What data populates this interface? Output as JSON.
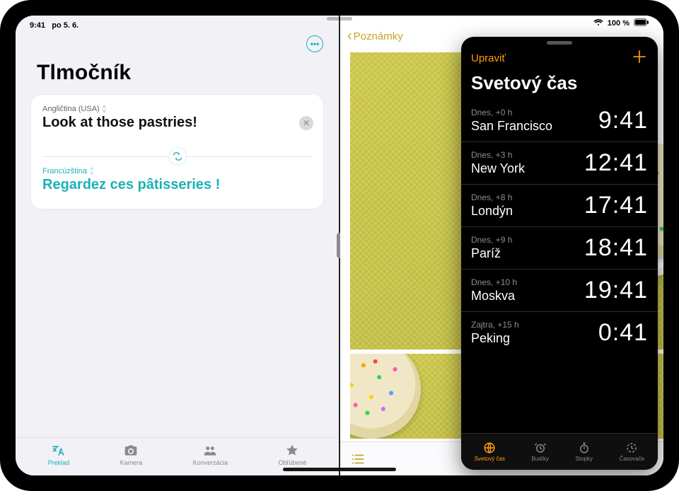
{
  "statusbar": {
    "time": "9:41",
    "date": "po 5. 6.",
    "battery_pct": "100 %"
  },
  "translator": {
    "title": "Tlmočník",
    "more_label": "•••",
    "source_language": "Angličtina (USA)",
    "source_text": "Look at those pastries!",
    "target_language": "Francúzština",
    "target_text": "Regardez ces pâtisseries !",
    "tabs": [
      {
        "label": "Preklad",
        "icon": "translate-icon",
        "active": true
      },
      {
        "label": "Kamera",
        "icon": "camera-icon",
        "active": false
      },
      {
        "label": "Konverzácia",
        "icon": "people-icon",
        "active": false
      },
      {
        "label": "Obľúbené",
        "icon": "star-icon",
        "active": false
      }
    ]
  },
  "notes": {
    "back_label": "Poznámky"
  },
  "clock": {
    "edit_label": "Upraviť",
    "title": "Svetový čas",
    "rows": [
      {
        "offset": "Dnes, +0 h",
        "city": "San Francisco",
        "time": "9:41"
      },
      {
        "offset": "Dnes, +3 h",
        "city": "New York",
        "time": "12:41"
      },
      {
        "offset": "Dnes, +8 h",
        "city": "Londýn",
        "time": "17:41"
      },
      {
        "offset": "Dnes, +9 h",
        "city": "Paríž",
        "time": "18:41"
      },
      {
        "offset": "Dnes, +10 h",
        "city": "Moskva",
        "time": "19:41"
      },
      {
        "offset": "Zajtra, +15 h",
        "city": "Peking",
        "time": "0:41"
      }
    ],
    "tabs": [
      {
        "label": "Svetový čas",
        "icon": "globe-icon",
        "active": true
      },
      {
        "label": "Budíky",
        "icon": "alarm-icon",
        "active": false
      },
      {
        "label": "Stopky",
        "icon": "stopwatch-icon",
        "active": false
      },
      {
        "label": "Časovače",
        "icon": "timer-icon",
        "active": false
      }
    ]
  }
}
